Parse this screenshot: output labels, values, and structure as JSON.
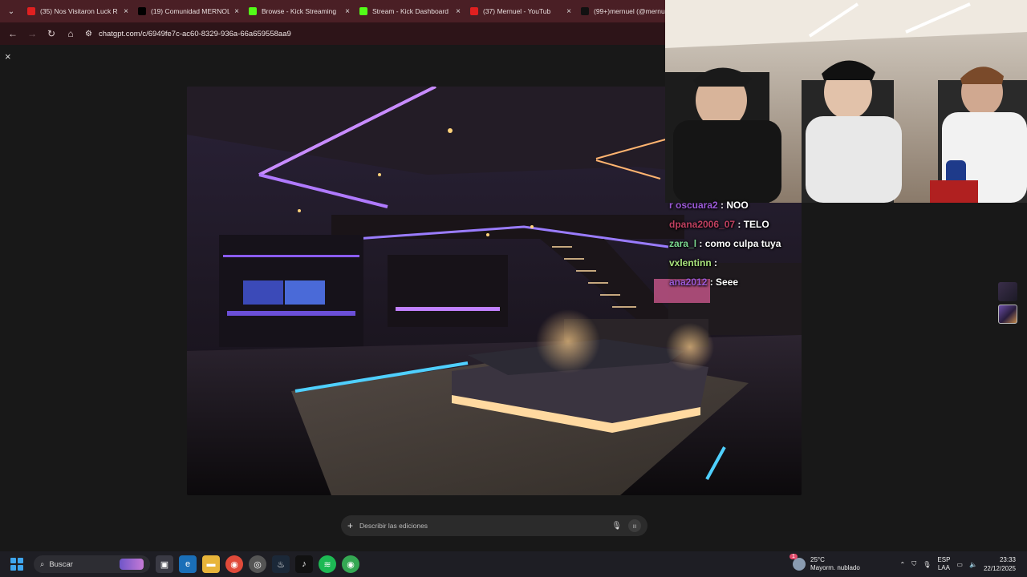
{
  "browser": {
    "tabs": [
      {
        "label": "(35) Nos Visitaron Luck R",
        "icon": "youtube-icon",
        "color": "#e02020"
      },
      {
        "label": "(19) Comunidad MERNOL",
        "icon": "x-icon",
        "color": "#000000"
      },
      {
        "label": "Browse - Kick Streaming",
        "icon": "kick-icon",
        "color": "#53fc18"
      },
      {
        "label": "Stream - Kick Dashboard",
        "icon": "kick-icon",
        "color": "#53fc18"
      },
      {
        "label": "(37) Mernuel - YouTub",
        "icon": "youtube-icon",
        "color": "#e02020"
      },
      {
        "label": "(99+)mernuel (@mernue",
        "icon": "tiktok-icon",
        "color": "#111111"
      }
    ],
    "url": "chatgpt.com/c/6949fe7c-ac60-8329-936a-66a659558aa9",
    "tabbar_color": "#4a1f25"
  },
  "editor": {
    "close_label": "×",
    "prompt_placeholder": "Describir las ediciones"
  },
  "chat": [
    {
      "user": "r oscuara2",
      "msg": " : NOO",
      "color": "#9b59d6"
    },
    {
      "user": "dpana2006_07",
      "msg": " : TELO",
      "color": "#c04060"
    },
    {
      "user": "zara_l",
      "msg": " : como culpa tuya",
      "color": "#7bd88f"
    },
    {
      "user": "vxlentinn",
      "msg": " : ",
      "color": "#a8e27b"
    },
    {
      "user": "ana2012",
      "msg": " : Seee",
      "color": "#9b59d6"
    }
  ],
  "taskbar": {
    "search_label": "Buscar",
    "weather_temp": "25°C",
    "weather_desc": "Mayorm. nublado",
    "weather_badge": "1",
    "lang_line1": "ESP",
    "lang_line2": "LAA",
    "time": "23:33",
    "date": "22/12/2025"
  }
}
